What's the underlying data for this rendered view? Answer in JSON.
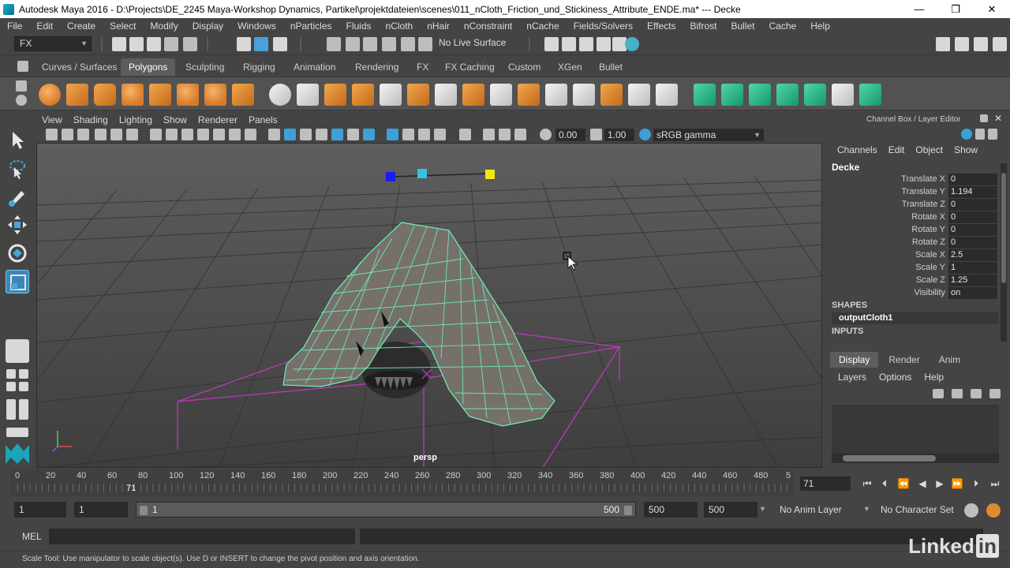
{
  "window": {
    "title": "Autodesk Maya 2016 - D:\\Projects\\DE_2245 Maya-Workshop Dynamics, Partikel\\projektdateien\\scenes\\011_nCloth_Friction_und_Stickiness_Attribute_ENDE.ma*  ---  Decke",
    "min": "—",
    "max": "❐",
    "close": "✕"
  },
  "menu": [
    "File",
    "Edit",
    "Create",
    "Select",
    "Modify",
    "Display",
    "Windows",
    "nParticles",
    "Fluids",
    "nCloth",
    "nHair",
    "nConstraint",
    "nCache",
    "Fields/Solvers",
    "Effects",
    "Bifrost",
    "Bullet",
    "Cache",
    "Help"
  ],
  "status": {
    "menuset": "FX",
    "live_surface": "No Live Surface"
  },
  "shelf_tabs": [
    "Curves / Surfaces",
    "Polygons",
    "Sculpting",
    "Rigging",
    "Animation",
    "Rendering",
    "FX",
    "FX Caching",
    "Custom",
    "XGen",
    "Bullet"
  ],
  "viewport": {
    "menu": [
      "View",
      "Shading",
      "Lighting",
      "Show",
      "Renderer",
      "Panels"
    ],
    "exposure": "0.00",
    "gamma": "1.00",
    "color_space": "sRGB gamma",
    "camera": "persp"
  },
  "channel_box": {
    "title": "Channel Box / Layer Editor",
    "menu": [
      "Channels",
      "Edit",
      "Object",
      "Show"
    ],
    "object": "Decke",
    "attributes": [
      {
        "name": "Translate X",
        "value": "0"
      },
      {
        "name": "Translate Y",
        "value": "1.194"
      },
      {
        "name": "Translate Z",
        "value": "0"
      },
      {
        "name": "Rotate X",
        "value": "0"
      },
      {
        "name": "Rotate Y",
        "value": "0"
      },
      {
        "name": "Rotate Z",
        "value": "0"
      },
      {
        "name": "Scale X",
        "value": "2.5"
      },
      {
        "name": "Scale Y",
        "value": "1"
      },
      {
        "name": "Scale Z",
        "value": "1.25"
      },
      {
        "name": "Visibility",
        "value": "on"
      }
    ],
    "shapes_label": "SHAPES",
    "shape": "outputCloth1",
    "inputs_label": "INPUTS",
    "tabs": [
      "Display",
      "Render",
      "Anim"
    ],
    "layer_menu": [
      "Layers",
      "Options",
      "Help"
    ]
  },
  "timeline": {
    "ticks": [
      "0",
      "20",
      "40",
      "60",
      "80",
      "100",
      "120",
      "140",
      "160",
      "180",
      "200",
      "220",
      "240",
      "260",
      "280",
      "300",
      "320",
      "340",
      "360",
      "380",
      "400",
      "420",
      "440",
      "460",
      "480",
      "5"
    ],
    "current": "71",
    "current_field": "71"
  },
  "range": {
    "start": "1",
    "anim_start": "1",
    "slider_start": "1",
    "slider_end": "500",
    "anim_end": "500",
    "end": "500",
    "anim_layer": "No Anim Layer",
    "char_set": "No Character Set"
  },
  "command": {
    "label": "MEL"
  },
  "help_line": "Scale Tool: Use manipulator to scale object(s). Use D or INSERT to change the pivot position and axis orientation.",
  "watermark": {
    "text": "Linked",
    "in": "in"
  }
}
